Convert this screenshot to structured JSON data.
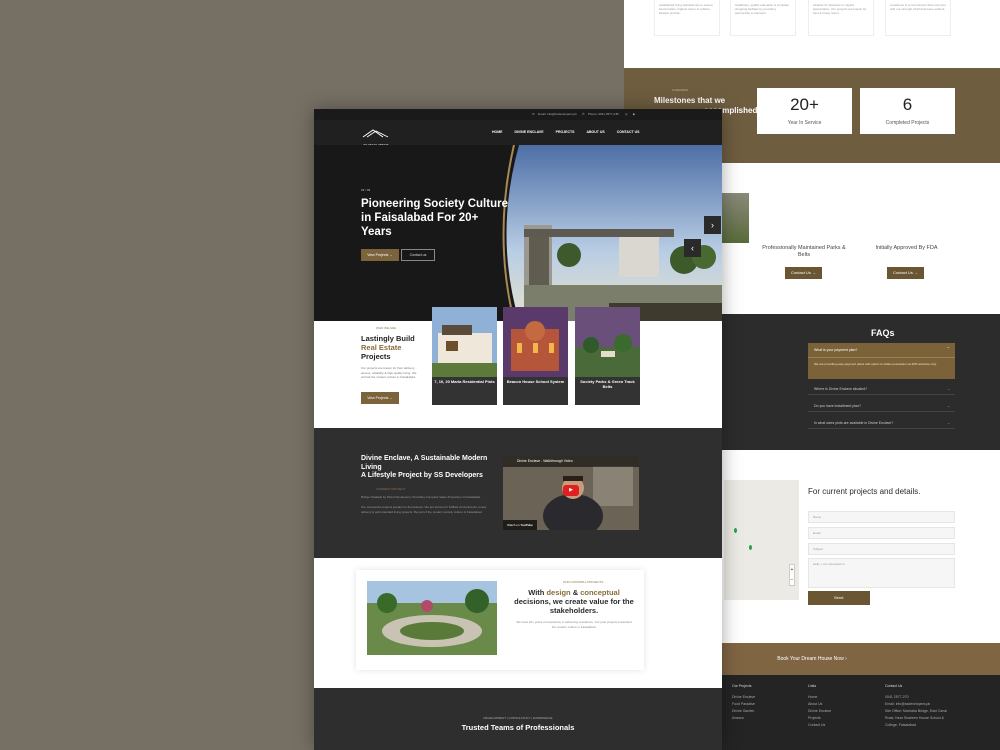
{
  "back": {
    "milestones": {
      "eyebrow": "OVERVIEW",
      "title": "Milestones that we",
      "title_overlap": "accomplished &",
      "stats": [
        {
          "value": "20+",
          "label": "Year In Service"
        },
        {
          "value": "6",
          "label": "Completed Projects"
        }
      ]
    },
    "features": [
      {
        "label": "Professionally Maintained Parks & Belts"
      },
      {
        "label": "Initially Approved By FDA"
      }
    ],
    "contact_button": "Contact Us",
    "faq": {
      "title": "FAQs",
      "items": [
        {
          "q": "What is your payment plan?",
          "a": "We are providing easy payment plans with option to obtain possession at 20% advance only."
        },
        {
          "q": "Where is Divine Enclave situated?"
        },
        {
          "q": "Do you have installment plan?"
        },
        {
          "q": "In what sizes plots are available in Divine Enclave?"
        }
      ]
    },
    "contact": {
      "title": "For current projects and details.",
      "fields": [
        "Name",
        "Email",
        "Subject",
        "Hello, I am interested in.."
      ],
      "send": "Send"
    },
    "cta": "Book Your Dream House Now",
    "footer": {
      "col1_title": "Our Projects",
      "col1": [
        "Divine Enclave",
        "Food Paradise",
        "Divine Garden",
        "Avanza"
      ],
      "col2_title": "Links",
      "col2": [
        "Home",
        "About Us",
        "Divine Enclave",
        "Projects",
        "Contact Us"
      ],
      "col3_title": "Contact Us",
      "col3": [
        "0041 2577-270",
        "Email: info@ssdevelopers.pk",
        "Site Office: Marhaba Bridge, East Canal Road, Near Shaheen House School & College, Faisalabad"
      ]
    }
  },
  "front": {
    "topbar": {
      "email": "Email: info@ssdevelopers.pk",
      "phone": "Phone: 0041 2577-270"
    },
    "logo": "SS DEVELOPERS",
    "nav": [
      "HOME",
      "DIVINE ENCLAVE",
      "PROJECTS",
      "ABOUT US",
      "CONTACT US"
    ],
    "hero": {
      "counter": "01 / 03",
      "title": "Pioneering Society Culture in Faisalabad For 20+ Years",
      "btn_primary": "View Projects",
      "btn_secondary": "Contact us"
    },
    "about": {
      "eyebrow": "WHO WE ARE",
      "title_1": "Lastingly Build",
      "title_gold": "Real Estate",
      "title_2": "Projects",
      "body": "Our projects are known for their delivery, access, reliability & high-quality living. We portrait the modern culture in Faisalabad.",
      "btn": "View Projects"
    },
    "projects": [
      {
        "label": "7, 10, 20 Marla Residential Plots"
      },
      {
        "label": "Beacon House School System"
      },
      {
        "label": "Society Parks & Green Track Belts"
      }
    ],
    "divine": {
      "title_1": "Divine Enclave, A Sustainable Modern Living",
      "title_2": "A Lifestyle Project by SS Developers",
      "eyebrow": "CURRENT PROJECT",
      "body": "Bridge Chakwal by Petrol Developers. Providing Complete Value Properties in Faisalabad.",
      "body2": "Our successful projects speaks for themselves. We are known for fulfilled commitments, timely delivery & gold standard living projects. Be part of the modern society culture in Faisalabad.",
      "video_title": "Divine Enclave - Walkthrough Video",
      "watch": "Watch on",
      "yt": "YouTube"
    },
    "decisions": {
      "eyebrow": "OUR GOODWILL PROJECTS",
      "text_1": "With ",
      "gold_1": "design",
      "text_2": " & ",
      "gold_2": "conceptual",
      "text_3": " decisions, we create value for the stakeholders.",
      "body": "We have 20+ years of experience in delivering excellence. Our past projects presented the modern culture in Faisalabad."
    },
    "trusted": {
      "eyebrow": "DEVELOPMENT | CONSULTANCY | EXPERIENCE",
      "title": "Trusted Teams of Professionals"
    }
  },
  "colors": {
    "gold": "#7b633b",
    "dark": "#2f2f2f",
    "beige": "#767064"
  }
}
